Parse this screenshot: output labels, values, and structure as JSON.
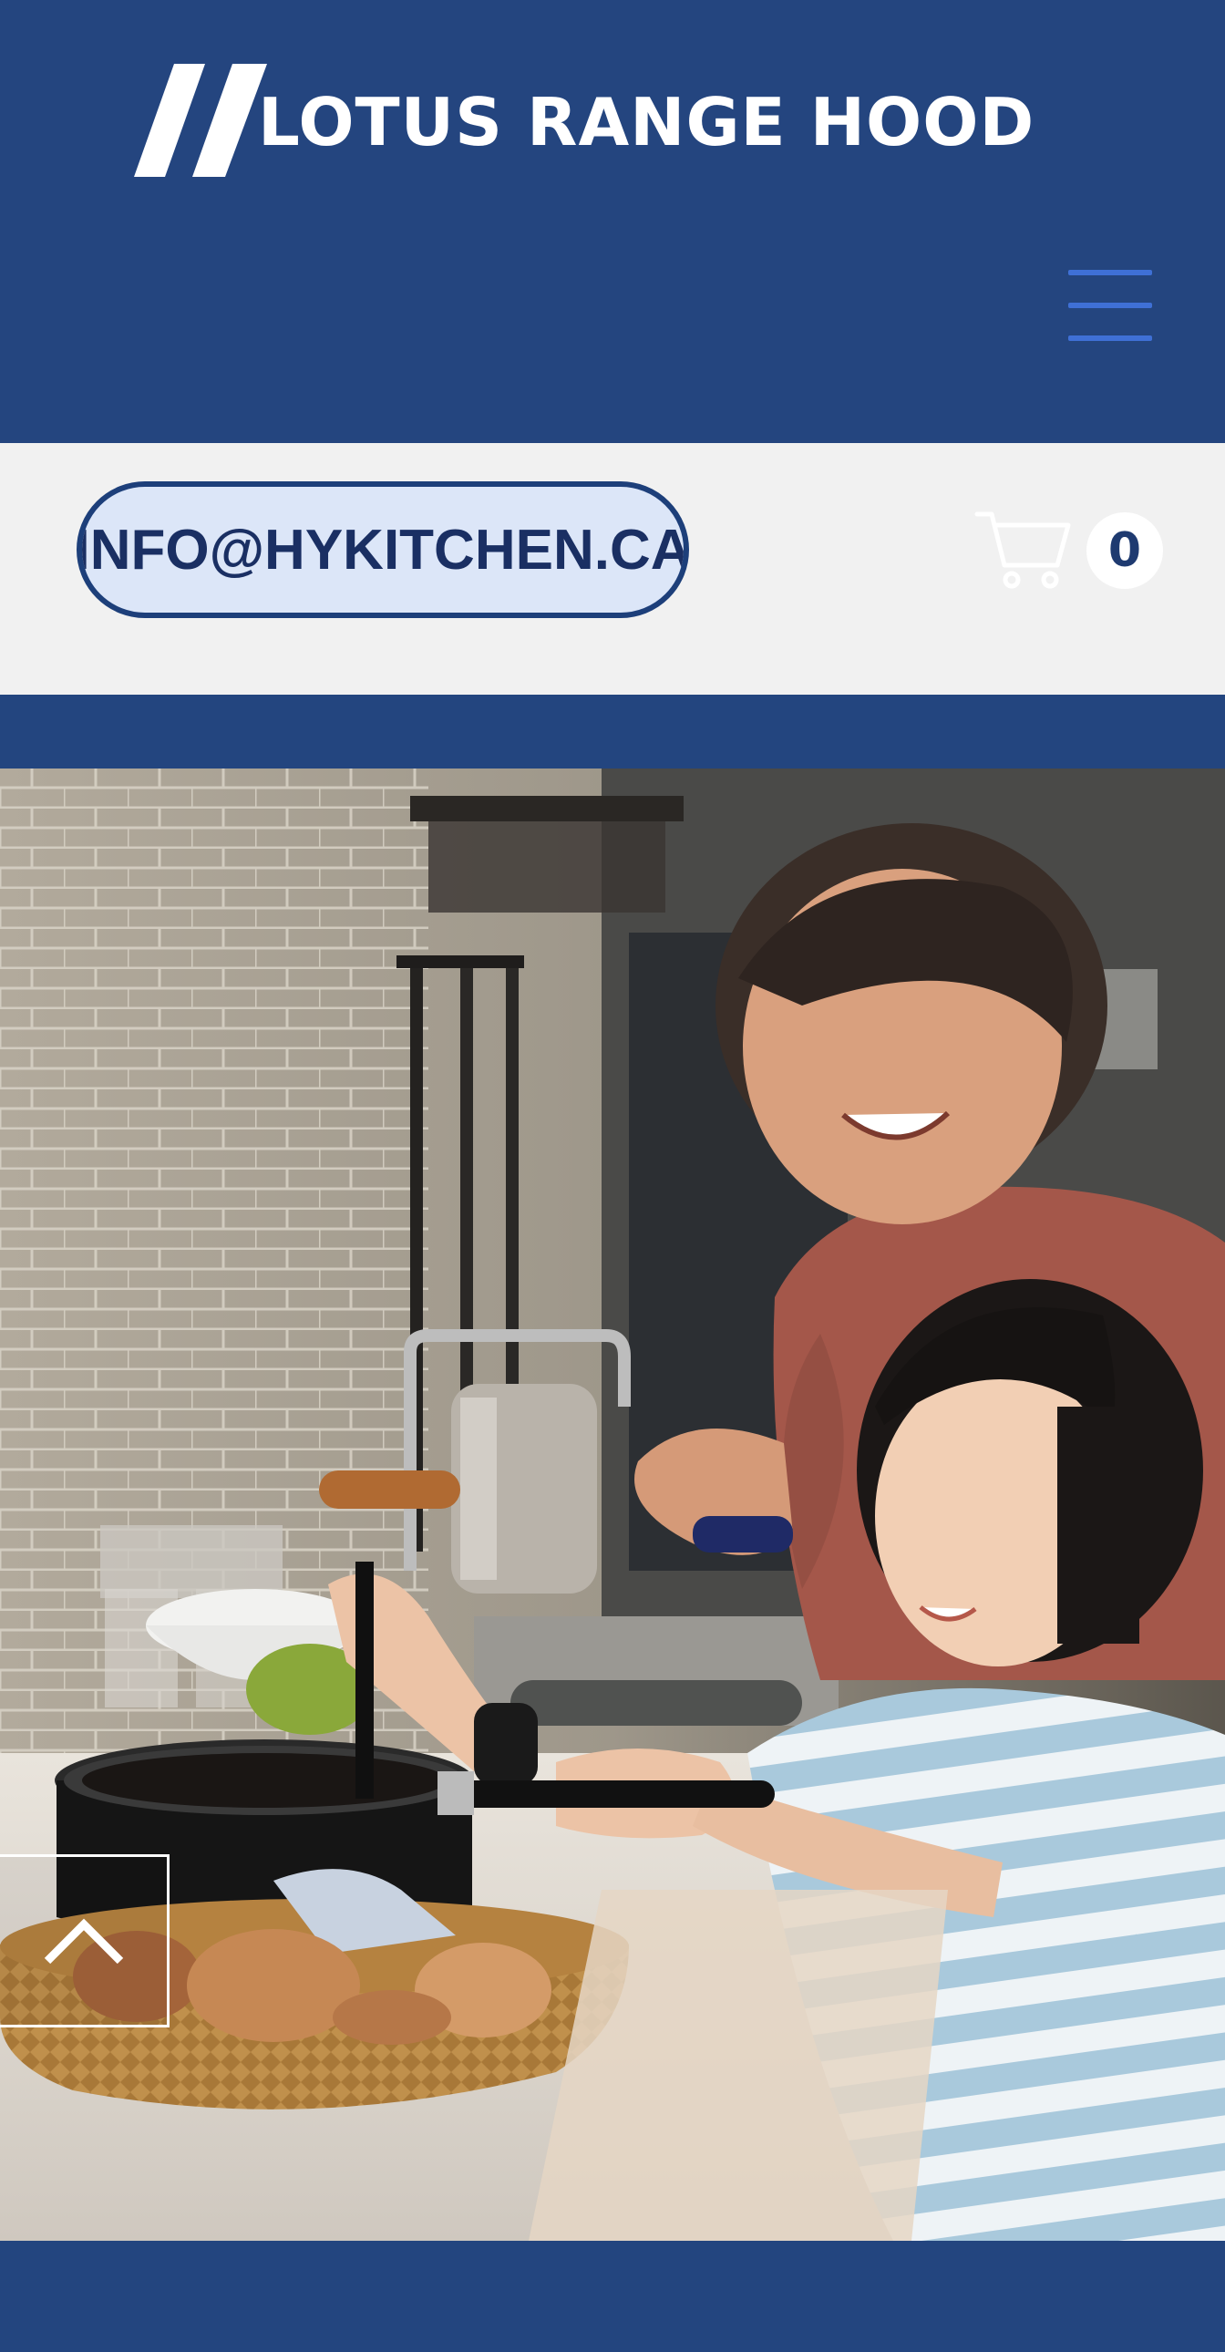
{
  "brand": {
    "name": "LOTUS RANGE HOOD",
    "logo_icon": "double-slash-logo",
    "background_color": "#24457f",
    "text_color": "#ffffff"
  },
  "header": {
    "menu_icon": "hamburger-menu-icon",
    "menu_icon_color": "#3f70d6"
  },
  "topbar": {
    "email": "INFO@HYKITCHEN.CA",
    "email_pill_fill": "#dce6f8",
    "email_pill_border": "#1d3f7a",
    "cart_icon": "shopping-cart-icon",
    "cart_count": "0"
  },
  "hero": {
    "image": "photo of a woman and a young girl cooking together in a kitchen with a pot and a basket of eggs"
  },
  "scroll_top": {
    "icon": "chevron-up-icon"
  }
}
